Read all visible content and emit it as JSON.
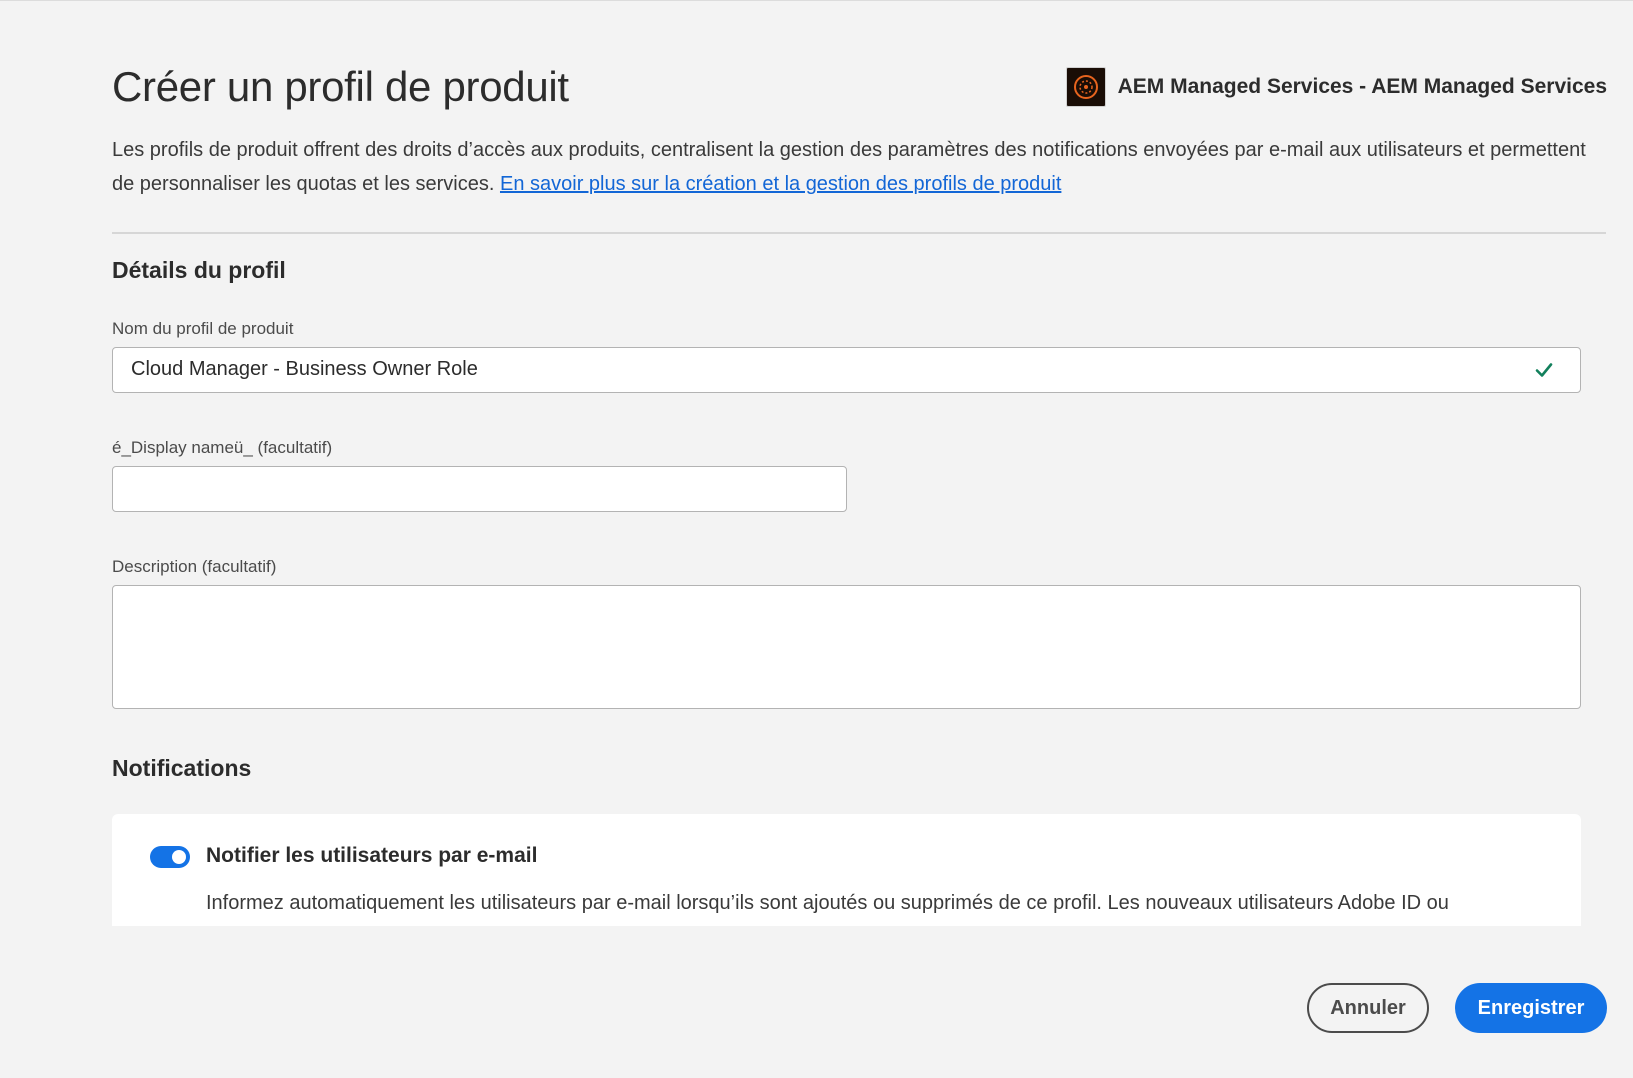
{
  "page": {
    "title": "Créer un profil de produit",
    "intro_text": "Les profils de produit offrent des droits d’accès aux produits, centralisent la gestion des paramètres des notifications envoyées par e-mail aux utilisateurs et permettent de personnaliser les quotas et les services.",
    "intro_link": "En savoir plus sur la création et la gestion des profils de produit"
  },
  "org": {
    "name": "AEM Managed Services - AEM Managed Services",
    "logo_icon": "aem-managed-services-logo"
  },
  "profile_details": {
    "section_title": "Détails du profil",
    "name_label": "Nom du profil de produit",
    "name_value": "Cloud Manager - Business Owner Role",
    "name_valid_icon": "checkmark-icon",
    "display_name_label": "é_Display nameü_ (facultatif)",
    "display_name_value": "",
    "description_label": "Description (facultatif)",
    "description_value": ""
  },
  "notifications": {
    "section_title": "Notifications",
    "toggle_on": true,
    "toggle_label": "Notifier les utilisateurs par e-mail",
    "toggle_description": "Informez automatiquement les utilisateurs par e-mail lorsqu’ils sont ajoutés ou supprimés de ce profil. Les nouveaux utilisateurs Adobe ID ou Enterprise ID recevront un e-mail les invitant à finaliser la configuration de leur compte."
  },
  "actions": {
    "cancel_label": "Annuler",
    "save_label": "Enregistrer"
  },
  "colors": {
    "accent": "#1473e6",
    "link": "#1266d6",
    "valid": "#12805c",
    "background": "#f3f3f3"
  }
}
